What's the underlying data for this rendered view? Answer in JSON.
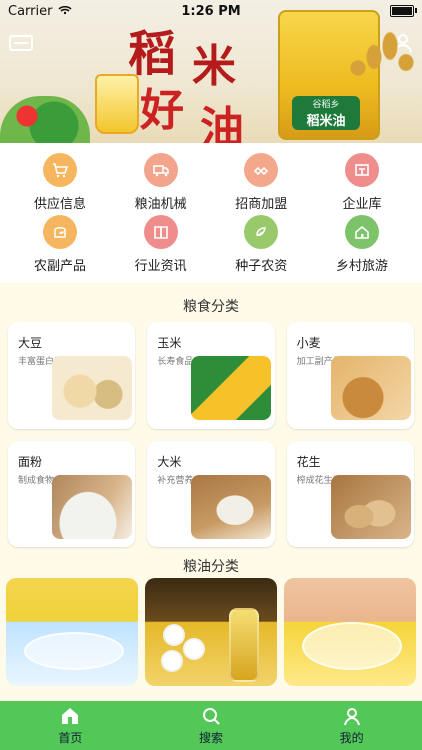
{
  "status_bar": {
    "carrier": "Carrier",
    "time": "1:26 PM"
  },
  "banner": {
    "chars": [
      "稻",
      "米",
      "好",
      "油"
    ],
    "bottle_brand": "谷稻乡",
    "bottle_name": "稻米油"
  },
  "quick_icons": [
    {
      "label": "供应信息",
      "icon": "cart-icon",
      "color": "#f6b65f"
    },
    {
      "label": "粮油机械",
      "icon": "truck-icon",
      "color": "#f2a58c"
    },
    {
      "label": "招商加盟",
      "icon": "handshake-icon",
      "color": "#f3a78b"
    },
    {
      "label": "企业库",
      "icon": "store-icon",
      "color": "#ef8d8d"
    },
    {
      "label": "农副产品",
      "icon": "leaf-bag-icon",
      "color": "#f6b65f"
    },
    {
      "label": "行业资讯",
      "icon": "book-icon",
      "color": "#ef8d8d"
    },
    {
      "label": "种子农资",
      "icon": "seed-icon",
      "color": "#98c96a"
    },
    {
      "label": "乡村旅游",
      "icon": "farmhouse-icon",
      "color": "#7cc36a"
    }
  ],
  "grain_section": {
    "title": "粮食分类",
    "items": [
      {
        "name": "大豆",
        "sub": "丰富蛋白质"
      },
      {
        "name": "玉米",
        "sub": "长寿食品"
      },
      {
        "name": "小麦",
        "sub": "加工副产品"
      },
      {
        "name": "面粉",
        "sub": "制成食物"
      },
      {
        "name": "大米",
        "sub": "补充营养素"
      },
      {
        "name": "花生",
        "sub": "榨成花生油"
      }
    ]
  },
  "oil_section": {
    "title": "粮油分类"
  },
  "tabbar": {
    "items": [
      {
        "label": "首页"
      },
      {
        "label": "搜索"
      },
      {
        "label": "我的"
      }
    ]
  }
}
